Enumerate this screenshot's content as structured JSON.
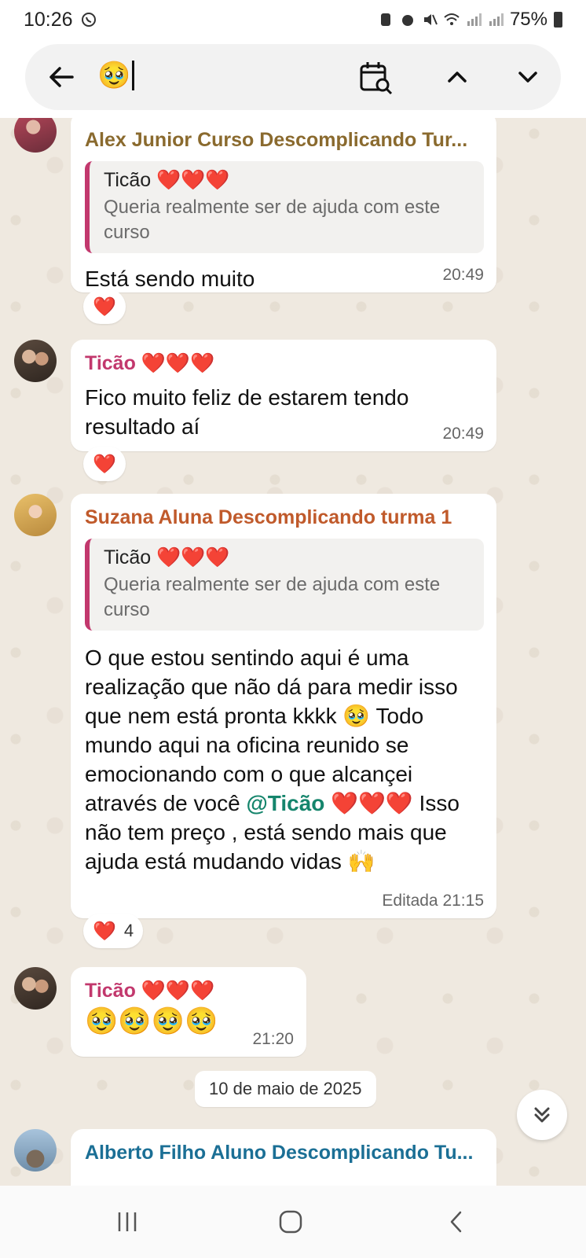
{
  "status_bar": {
    "time": "10:26",
    "battery": "75%"
  },
  "search": {
    "query": "🥹"
  },
  "messages": [
    {
      "sender": "Alex Junior Curso Descomplicando Tur...",
      "quote_name": "Ticão ❤️❤️❤️",
      "quote_text": "Queria realmente ser de ajuda com este curso",
      "text": "Está sendo muito",
      "time": "20:49",
      "reaction": "❤️"
    },
    {
      "sender": "Ticão ❤️❤️❤️",
      "text": "Fico muito feliz de estarem tendo resultado aí",
      "time": "20:49",
      "reaction": "❤️"
    },
    {
      "sender": "Suzana Aluna Descomplicando turma 1",
      "quote_name": "Ticão ❤️❤️❤️",
      "quote_text": "Queria realmente ser de ajuda com este curso",
      "text_a": "O que estou sentindo aqui é uma realização que não dá para medir isso que nem está pronta kkkk 🥹 Todo mundo aqui na oficina reunido se emocionando com o que alcançei através de você",
      "mention": "@Ticão",
      "text_b": "❤️❤️❤️ Isso não tem preço , está sendo mais que ajuda está mudando vidas 🙌",
      "time": "Editada 21:15",
      "reaction": "❤️",
      "reaction_count": "4"
    },
    {
      "sender": "Ticão ❤️❤️❤️",
      "text": "🥹🥹🥹🥹",
      "time": "21:20"
    },
    {
      "sender": "Alberto Filho Aluno Descomplicando Tu..."
    }
  ],
  "date_divider": "10 de maio de 2025"
}
